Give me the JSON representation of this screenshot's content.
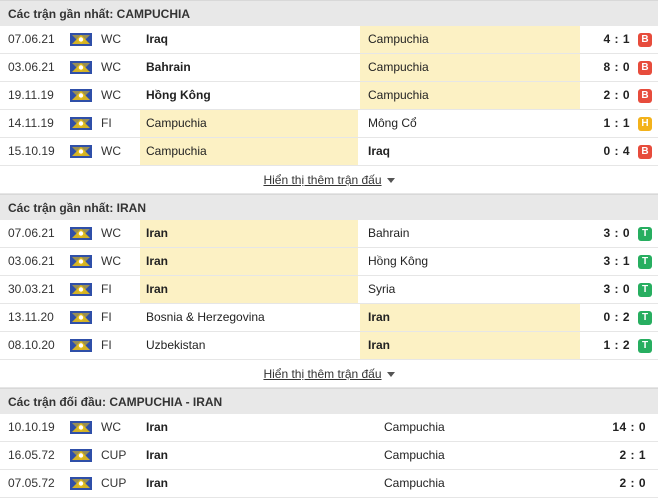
{
  "sections": [
    {
      "title": "Các trận gần nhất: CAMPUCHIA",
      "more_label": "Hiển thị thêm trận đấu",
      "rows": [
        {
          "date": "07.06.21",
          "comp": "WC",
          "home": "Iraq",
          "away": "Campuchia",
          "score": "4 : 1",
          "result": "B",
          "home_bold": true,
          "away_bold": false,
          "home_hl": false,
          "away_hl": true
        },
        {
          "date": "03.06.21",
          "comp": "WC",
          "home": "Bahrain",
          "away": "Campuchia",
          "score": "8 : 0",
          "result": "B",
          "home_bold": true,
          "away_bold": false,
          "home_hl": false,
          "away_hl": true
        },
        {
          "date": "19.11.19",
          "comp": "WC",
          "home": "Hồng Kông",
          "away": "Campuchia",
          "score": "2 : 0",
          "result": "B",
          "home_bold": true,
          "away_bold": false,
          "home_hl": false,
          "away_hl": true
        },
        {
          "date": "14.11.19",
          "comp": "FI",
          "home": "Campuchia",
          "away": "Mông Cổ",
          "score": "1 : 1",
          "result": "H",
          "home_bold": false,
          "away_bold": false,
          "home_hl": true,
          "away_hl": false
        },
        {
          "date": "15.10.19",
          "comp": "WC",
          "home": "Campuchia",
          "away": "Iraq",
          "score": "0 : 4",
          "result": "B",
          "home_bold": false,
          "away_bold": true,
          "home_hl": true,
          "away_hl": false
        }
      ]
    },
    {
      "title": "Các trận gần nhất: IRAN",
      "more_label": "Hiển thị thêm trận đấu",
      "rows": [
        {
          "date": "07.06.21",
          "comp": "WC",
          "home": "Iran",
          "away": "Bahrain",
          "score": "3 : 0",
          "result": "T",
          "home_bold": true,
          "away_bold": false,
          "home_hl": true,
          "away_hl": false
        },
        {
          "date": "03.06.21",
          "comp": "WC",
          "home": "Iran",
          "away": "Hồng Kông",
          "score": "3 : 1",
          "result": "T",
          "home_bold": true,
          "away_bold": false,
          "home_hl": true,
          "away_hl": false
        },
        {
          "date": "30.03.21",
          "comp": "FI",
          "home": "Iran",
          "away": "Syria",
          "score": "3 : 0",
          "result": "T",
          "home_bold": true,
          "away_bold": false,
          "home_hl": true,
          "away_hl": false
        },
        {
          "date": "13.11.20",
          "comp": "FI",
          "home": "Bosnia & Herzegovina",
          "away": "Iran",
          "score": "0 : 2",
          "result": "T",
          "home_bold": false,
          "away_bold": true,
          "home_hl": false,
          "away_hl": true
        },
        {
          "date": "08.10.20",
          "comp": "FI",
          "home": "Uzbekistan",
          "away": "Iran",
          "score": "1 : 2",
          "result": "T",
          "home_bold": false,
          "away_bold": true,
          "home_hl": false,
          "away_hl": true
        }
      ]
    }
  ],
  "h2h": {
    "title": "Các trận đối đầu: CAMPUCHIA - IRAN",
    "rows": [
      {
        "date": "10.10.19",
        "comp": "WC",
        "home": "Iran",
        "away": "Campuchia",
        "score": "14 : 0",
        "home_bold": true
      },
      {
        "date": "16.05.72",
        "comp": "CUP",
        "home": "Iran",
        "away": "Campuchia",
        "score": "2 : 1",
        "home_bold": true
      },
      {
        "date": "07.05.72",
        "comp": "CUP",
        "home": "Iran",
        "away": "Campuchia",
        "score": "2 : 0",
        "home_bold": true
      }
    ]
  },
  "colors": {
    "highlight": "#fcf1c4",
    "loss": "#e74c3c",
    "draw": "#f3b21b",
    "win": "#27ae60",
    "header_bg": "#e8e8e8"
  },
  "icons": {
    "competition": "world-flag-icon",
    "more": "caret-down-icon"
  }
}
